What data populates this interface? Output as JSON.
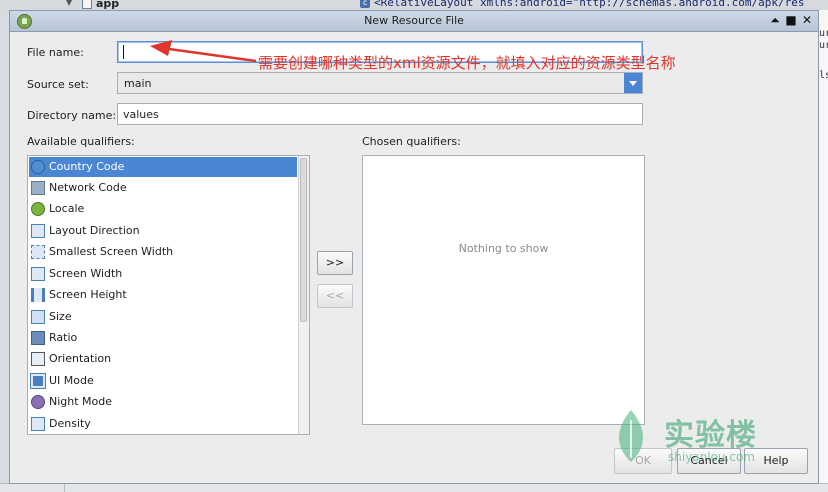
{
  "background": {
    "project_label": "app",
    "code_line": "<RelativeLayout xmlns:android=\"http://schemas.android.com/apk/res",
    "code_icon_letter": "c",
    "right_fragments": [
      "ur",
      "ur",
      "ls"
    ]
  },
  "dialog": {
    "title": "New Resource File",
    "controls": {
      "minimize": "⏶",
      "maximize": "■",
      "close": "✕"
    }
  },
  "form": {
    "file_name_label": "File name:",
    "file_name_value": "",
    "source_set_label": "Source set:",
    "source_set_value": "main",
    "directory_label": "Directory name:",
    "directory_value": "values"
  },
  "available": {
    "label": "Available qualifiers:",
    "items": [
      {
        "label": "Country Code",
        "icon": "globe-icon",
        "selected": true
      },
      {
        "label": "Network Code",
        "icon": "network-icon"
      },
      {
        "label": "Locale",
        "icon": "locale-icon"
      },
      {
        "label": "Layout Direction",
        "icon": "layout-direction-icon"
      },
      {
        "label": "Smallest Screen Width",
        "icon": "smallest-width-icon"
      },
      {
        "label": "Screen Width",
        "icon": "screen-width-icon"
      },
      {
        "label": "Screen Height",
        "icon": "screen-height-icon"
      },
      {
        "label": "Size",
        "icon": "size-icon"
      },
      {
        "label": "Ratio",
        "icon": "ratio-icon"
      },
      {
        "label": "Orientation",
        "icon": "orientation-icon"
      },
      {
        "label": "UI Mode",
        "icon": "ui-mode-icon"
      },
      {
        "label": "Night Mode",
        "icon": "night-mode-icon"
      },
      {
        "label": "Density",
        "icon": "density-icon"
      }
    ]
  },
  "chosen": {
    "label": "Chosen qualifiers:",
    "empty_text": "Nothing to show"
  },
  "buttons": {
    "add": ">>",
    "remove": "<<",
    "ok": "OK",
    "cancel": "Cancel",
    "help": "Help"
  },
  "annotation": {
    "text": "需要创建哪种类型的xml资源文件，就填入对应的资源类型名称",
    "color": "#e0352b"
  },
  "watermark": {
    "cn": "实验楼",
    "en": "shiyanlou.com",
    "color": "#2f9e6a"
  }
}
